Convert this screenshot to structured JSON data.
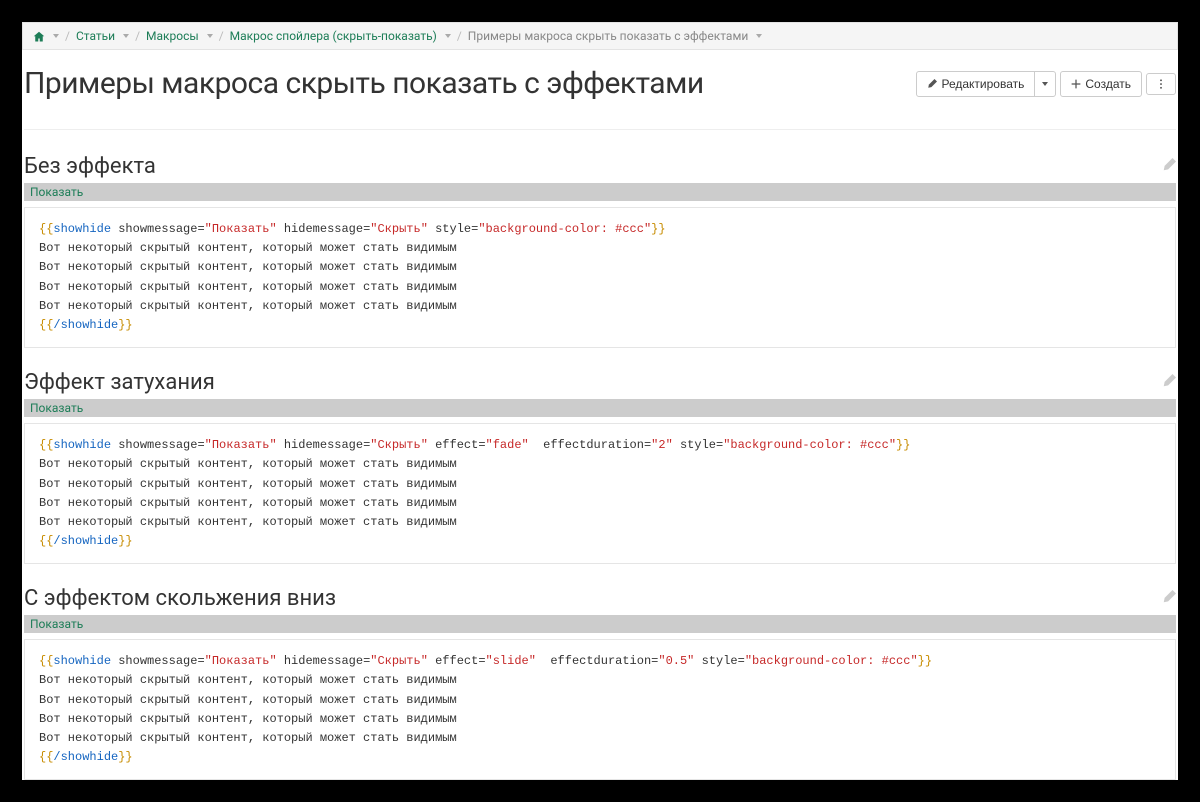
{
  "breadcrumb": {
    "home_title": "Главная",
    "items": [
      {
        "label": "Статьи"
      },
      {
        "label": "Макросы"
      },
      {
        "label": "Макрос спойлера (скрыть-показать)"
      }
    ],
    "current": "Примеры макроса скрыть показать с эффектами"
  },
  "page": {
    "title": "Примеры макроса скрыть показать с эффектами",
    "edit_label": "Редактировать",
    "create_label": "Создать"
  },
  "sections": [
    {
      "heading": "Без эффекта",
      "toggle_label": "Показать",
      "code": {
        "open_tag": "showhide",
        "attrs": [
          {
            "name": "showmessage",
            "value": "\"Показать\""
          },
          {
            "name": "hidemessage",
            "value": "\"Скрыть\""
          },
          {
            "name": "style",
            "value": "\"background-color: #ccc\""
          }
        ],
        "body_lines": [
          "Вот некоторый скрытый контент, который может стать видимым",
          "Вот некоторый скрытый контент, который может стать видимым",
          "Вот некоторый скрытый контент, который может стать видимым",
          "Вот некоторый скрытый контент, который может стать видимым"
        ],
        "close_tag": "/showhide"
      }
    },
    {
      "heading": "Эффект затухания",
      "toggle_label": "Показать",
      "code": {
        "open_tag": "showhide",
        "attrs": [
          {
            "name": "showmessage",
            "value": "\"Показать\""
          },
          {
            "name": "hidemessage",
            "value": "\"Скрыть\""
          },
          {
            "name": "effect",
            "value": "\"fade\""
          },
          {
            "name": "effectduration",
            "value": "\"2\""
          },
          {
            "name": "style",
            "value": "\"background-color: #ccc\""
          }
        ],
        "body_lines": [
          "Вот некоторый скрытый контент, который может стать видимым",
          "Вот некоторый скрытый контент, который может стать видимым",
          "Вот некоторый скрытый контент, который может стать видимым",
          "Вот некоторый скрытый контент, который может стать видимым"
        ],
        "close_tag": "/showhide"
      }
    },
    {
      "heading": "С эффектом скольжения вниз",
      "toggle_label": "Показать",
      "code": {
        "open_tag": "showhide",
        "attrs": [
          {
            "name": "showmessage",
            "value": "\"Показать\""
          },
          {
            "name": "hidemessage",
            "value": "\"Скрыть\""
          },
          {
            "name": "effect",
            "value": "\"slide\""
          },
          {
            "name": "effectduration",
            "value": "\"0.5\""
          },
          {
            "name": "style",
            "value": "\"background-color: #ccc\""
          }
        ],
        "body_lines": [
          "Вот некоторый скрытый контент, который может стать видимым",
          "Вот некоторый скрытый контент, который может стать видимым",
          "Вот некоторый скрытый контент, который может стать видимым",
          "Вот некоторый скрытый контент, который может стать видимым"
        ],
        "close_tag": "/showhide"
      }
    }
  ],
  "icons": {
    "pencil": "pencil-icon",
    "plus": "plus-icon",
    "home": "home-icon",
    "more": "more-vertical-icon",
    "caret": "caret-down-icon"
  }
}
